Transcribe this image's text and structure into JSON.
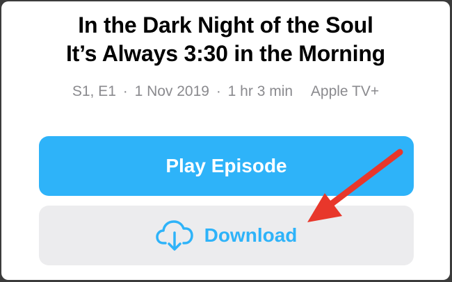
{
  "episode": {
    "title_line1": "In the Dark Night of the Soul",
    "title_line2": "It’s Always 3:30 in the Morning",
    "season_episode": "S1, E1",
    "air_date": "1 Nov 2019",
    "duration": "1 hr 3 min",
    "provider": "Apple TV+",
    "separator": "·"
  },
  "actions": {
    "play_label": "Play Episode",
    "download_label": "Download"
  },
  "icons": {
    "download": "cloud-download-icon",
    "annotation": "red-arrow"
  },
  "colors": {
    "accent": "#2eb3f9",
    "play_bg": "#2eb3f9",
    "download_bg": "#ececee",
    "meta_text": "#8a8a8e",
    "annotation_arrow": "#e8372b",
    "frame": "#3b3b3b"
  }
}
